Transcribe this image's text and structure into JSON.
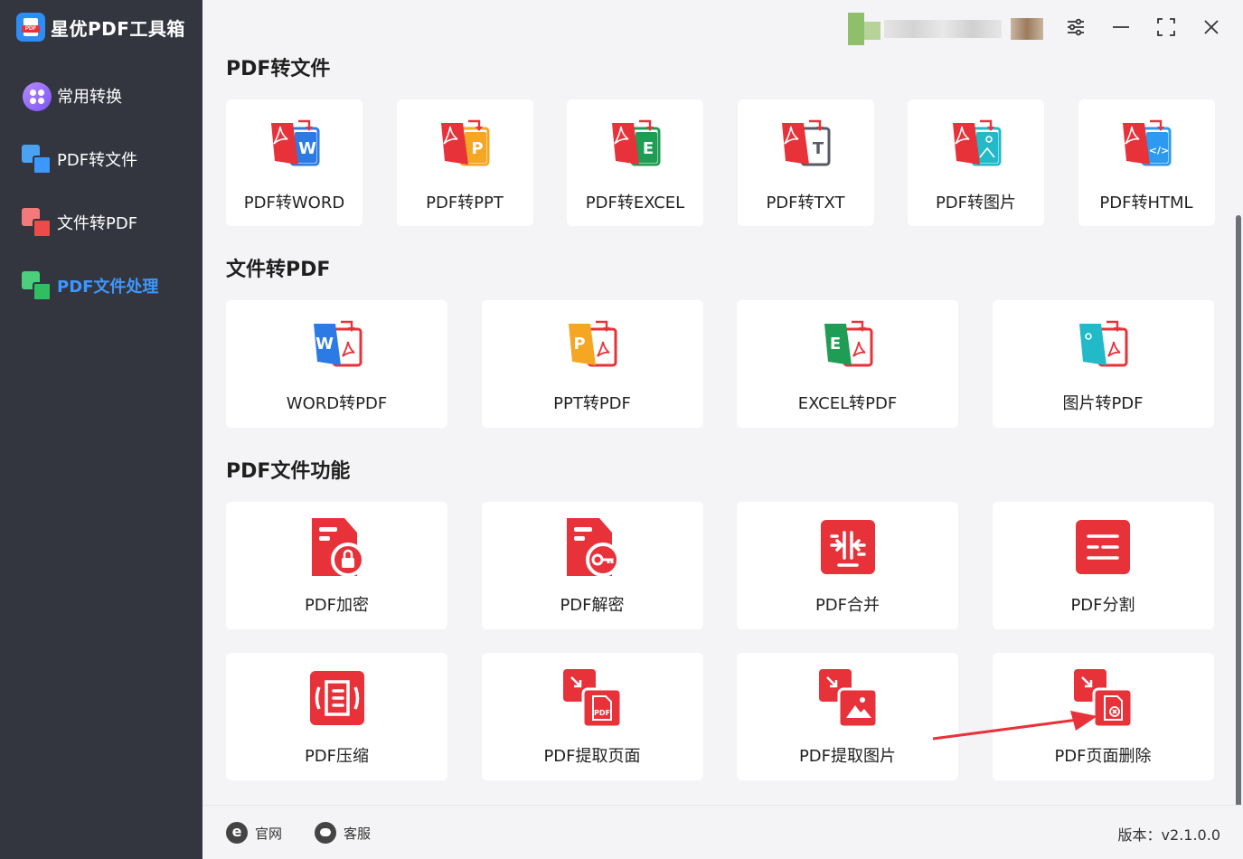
{
  "app": {
    "title": "星优PDF工具箱",
    "logo_tag": "PDF"
  },
  "sidebar": {
    "items": [
      {
        "label": "常用转换",
        "icon": "apps-icon"
      },
      {
        "label": "PDF转文件",
        "icon": "pdf-to-file-icon"
      },
      {
        "label": "文件转PDF",
        "icon": "file-to-pdf-icon"
      },
      {
        "label": "PDF文件处理",
        "icon": "pdf-process-icon",
        "active": true
      }
    ]
  },
  "sections": {
    "pdf_to_file": {
      "title": "PDF转文件",
      "cards": [
        {
          "label": "PDF转WORD",
          "glyph": "W",
          "color": "#2c7be5"
        },
        {
          "label": "PDF转PPT",
          "glyph": "P",
          "color": "#f5a623"
        },
        {
          "label": "PDF转EXCEL",
          "glyph": "E",
          "color": "#1f9d55"
        },
        {
          "label": "PDF转TXT",
          "glyph": "T",
          "color": "#555b66"
        },
        {
          "label": "PDF转图片",
          "glyph": "",
          "color": "#22b9c9"
        },
        {
          "label": "PDF转HTML",
          "glyph": "</>",
          "color": "#2c9af0"
        }
      ]
    },
    "file_to_pdf": {
      "title": "文件转PDF",
      "cards": [
        {
          "label": "WORD转PDF",
          "glyph": "W",
          "color": "#2c7be5"
        },
        {
          "label": "PPT转PDF",
          "glyph": "P",
          "color": "#f5a623"
        },
        {
          "label": "EXCEL转PDF",
          "glyph": "E",
          "color": "#1f9d55"
        },
        {
          "label": "图片转PDF",
          "glyph": "",
          "color": "#22b9c9"
        }
      ]
    },
    "pdf_functions": {
      "title": "PDF文件功能",
      "cards": [
        {
          "label": "PDF加密",
          "icon": "lock-icon"
        },
        {
          "label": "PDF解密",
          "icon": "key-icon"
        },
        {
          "label": "PDF合并",
          "icon": "merge-icon"
        },
        {
          "label": "PDF分割",
          "icon": "split-icon"
        },
        {
          "label": "PDF压缩",
          "icon": "compress-icon"
        },
        {
          "label": "PDF提取页面",
          "icon": "extract-page-icon",
          "mini": "PDF"
        },
        {
          "label": "PDF提取图片",
          "icon": "extract-image-icon"
        },
        {
          "label": "PDF页面删除",
          "icon": "delete-page-icon"
        }
      ]
    }
  },
  "footer": {
    "website_label": "官网",
    "support_label": "客服",
    "version_text": "版本：v2.1.0.0"
  },
  "colors": {
    "sidebar_bg": "#33363f",
    "accent": "#3d97ff",
    "pdf_red": "#e8323a"
  }
}
